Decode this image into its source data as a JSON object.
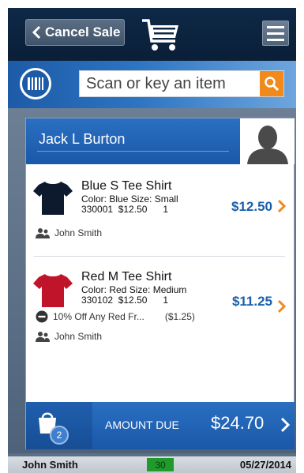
{
  "topbar": {
    "cancel_label": "Cancel Sale"
  },
  "search": {
    "placeholder": "Scan or key an item"
  },
  "customer": {
    "name": "Jack L Burton"
  },
  "items": [
    {
      "name": "Blue S Tee Shirt",
      "attributes": "Color: Blue  Size: Small",
      "sku_line": "330001  $12.50      1",
      "price": "$12.50",
      "salesperson": "John Smith",
      "shirt_color": "#0d1a2e"
    },
    {
      "name": "Red M Tee Shirt",
      "attributes": "Color: Red  Size: Medium",
      "sku_line": "330102  $12.50      1",
      "price": "$11.25",
      "discount_label": "10% Off Any Red Fr...",
      "discount_amount": "($1.25)",
      "salesperson": "John Smith",
      "shirt_color": "#c0142b"
    }
  ],
  "amount": {
    "bag_count": "2",
    "label": "AMOUNT DUE",
    "value": "$24.70"
  },
  "status": {
    "user": "John Smith",
    "counter": "30",
    "date": "05/27/2014"
  },
  "colors": {
    "accent_blue": "#1a5fae",
    "accent_orange": "#f08a1c",
    "status_green": "#1f9a2b"
  }
}
